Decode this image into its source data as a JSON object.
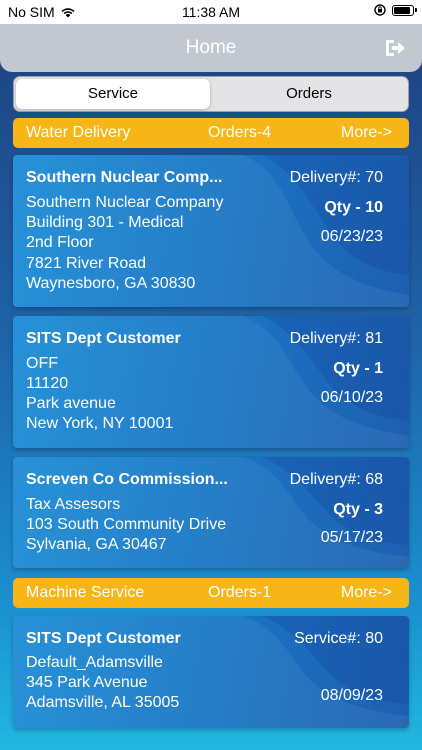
{
  "status_bar": {
    "carrier": "No SIM",
    "time": "11:38 AM"
  },
  "navbar": {
    "title": "Home",
    "logout_icon": "logout-icon"
  },
  "segments": {
    "service": "Service",
    "orders": "Orders"
  },
  "sections": [
    {
      "name": "Water Delivery",
      "orders": "Orders-4",
      "more": "More->"
    },
    {
      "name": "Machine Service",
      "orders": "Orders-1",
      "more": "More->"
    }
  ],
  "cards": [
    {
      "customer": "Southern Nuclear Comp...",
      "number": "Delivery#: 70",
      "qty": "Qty - 10",
      "date": "06/23/23",
      "address": [
        "Southern Nuclear Company",
        "Building 301 - Medical",
        "2nd Floor",
        "7821 River Road",
        "Waynesboro, GA 30830"
      ]
    },
    {
      "customer": "SITS Dept Customer",
      "number": "Delivery#: 81",
      "qty": "Qty - 1",
      "date": "06/10/23",
      "address": [
        "OFF",
        "11120",
        "Park avenue",
        "New York, NY 10001"
      ]
    },
    {
      "customer": "Screven Co Commission...",
      "number": "Delivery#: 68",
      "qty": "Qty - 3",
      "date": "05/17/23",
      "address": [
        "Tax Assesors",
        "103 South Community Drive",
        "Sylvania, GA 30467"
      ]
    },
    {
      "customer": "SITS Dept Customer",
      "number": "Service#: 80",
      "date": "08/09/23",
      "address": [
        "Default_Adamsville",
        "345 Park Avenue",
        "Adamsville, AL 35005"
      ]
    }
  ]
}
